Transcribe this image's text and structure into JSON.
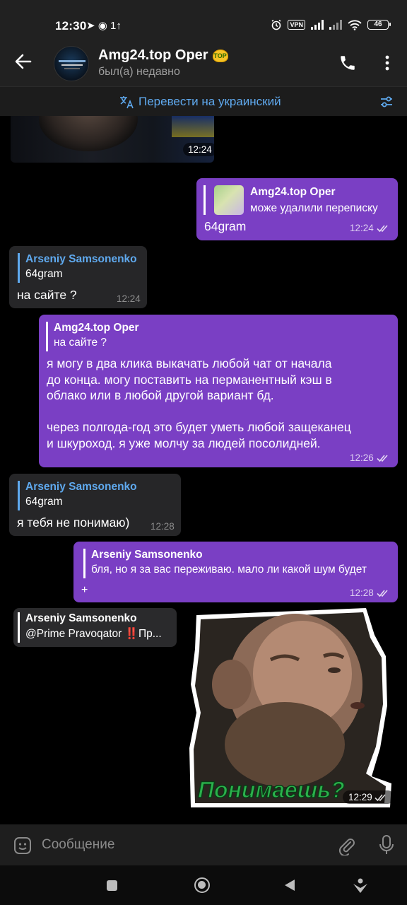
{
  "status_bar": {
    "time": "12:30",
    "left_icons": "➤ ◉ 1↑",
    "vpn": "VPN",
    "battery": "46"
  },
  "header": {
    "title": "Amg24.top Oper",
    "badge": "TOP",
    "subtitle": "был(а) недавно"
  },
  "translate_bar": {
    "label": "Перевести на украинский"
  },
  "messages": [
    {
      "type": "photo",
      "direction": "in",
      "time": "12:24"
    },
    {
      "direction": "out",
      "reply_name": "Amg24.top Oper",
      "reply_text": "може удалили переписку",
      "text": "64gram",
      "time": "12:24"
    },
    {
      "direction": "in",
      "reply_name": "Arseniy Samsonenko",
      "reply_text": "64gram",
      "text": "на сайте ?",
      "time": "12:24"
    },
    {
      "direction": "out",
      "reply_name": "Amg24.top Oper",
      "reply_text": "на сайте ?",
      "text_lines": [
        "я могу в два клика выкачать любой чат от начала",
        "до конца. могу поставить на перманентный кэш в",
        "облако или в любой другой вариант бд.",
        "",
        "через полгода-год это будет уметь любой защеканец",
        "и шкуроход. я уже молчу за людей посолидней."
      ],
      "time": "12:26"
    },
    {
      "direction": "in",
      "reply_name": "Arseniy Samsonenko",
      "reply_text": "64gram",
      "text": "я тебя не понимаю)",
      "time": "12:28"
    },
    {
      "direction": "out",
      "reply_name": "Arseniy Samsonenko",
      "reply_text": "бля, но я за вас переживаю. мало ли какой шум будет",
      "text": "+",
      "time": "12:28"
    },
    {
      "type": "sticker",
      "direction": "out",
      "reply_name": "Arseniy Samsonenko",
      "reply_text": "@Prime Pravoqator ‼️Пр...",
      "caption": "Понимаешь?",
      "time": "12:29"
    }
  ],
  "input": {
    "placeholder": "Сообщение"
  },
  "colors": {
    "outgoing_bubble": "#7a3fc4",
    "incoming_bubble": "#262628",
    "accent": "#5fa9ee"
  }
}
